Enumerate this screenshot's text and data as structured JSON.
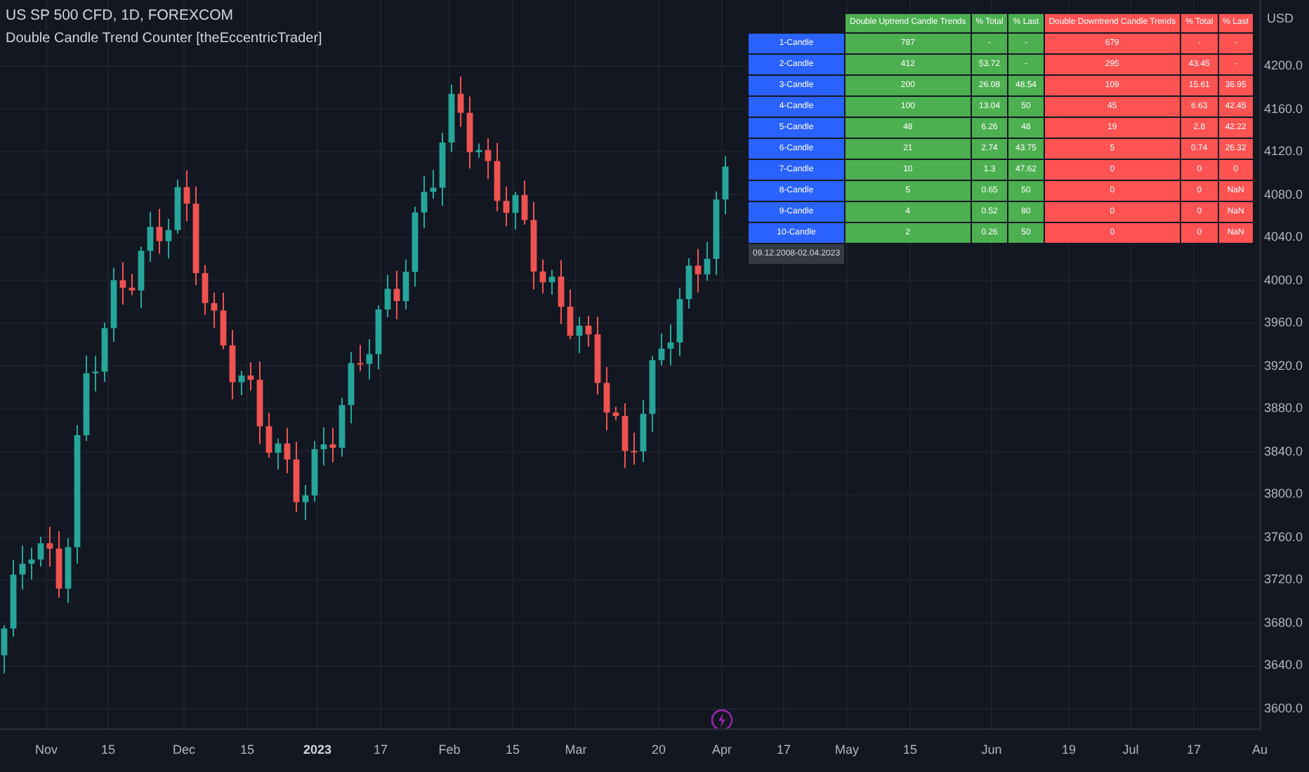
{
  "header": {
    "symbol": "US SP 500 CFD, 1D, FOREXCOM",
    "indicator": "Double Candle Trend Counter [theEccentricTrader]"
  },
  "price_axis": {
    "currency": "USD",
    "labels": [
      "4200.0",
      "4160.0",
      "4120.0",
      "4080.0",
      "4040.0",
      "4000.0",
      "3960.0",
      "3920.0",
      "3880.0",
      "3840.0",
      "3800.0",
      "3760.0",
      "3720.0",
      "3680.0",
      "3640.0",
      "3600.0"
    ]
  },
  "time_axis": {
    "labels": [
      {
        "text": "Nov",
        "kind": "month"
      },
      {
        "text": "15",
        "kind": "day"
      },
      {
        "text": "Dec",
        "kind": "month"
      },
      {
        "text": "15",
        "kind": "day"
      },
      {
        "text": "2023",
        "kind": "year"
      },
      {
        "text": "17",
        "kind": "day"
      },
      {
        "text": "Feb",
        "kind": "month"
      },
      {
        "text": "15",
        "kind": "day"
      },
      {
        "text": "Mar",
        "kind": "month"
      },
      {
        "text": "20",
        "kind": "day"
      },
      {
        "text": "Apr",
        "kind": "month"
      },
      {
        "text": "17",
        "kind": "day"
      },
      {
        "text": "May",
        "kind": "month"
      },
      {
        "text": "15",
        "kind": "day"
      },
      {
        "text": "Jun",
        "kind": "month"
      },
      {
        "text": "19",
        "kind": "day"
      },
      {
        "text": "Jul",
        "kind": "month"
      },
      {
        "text": "17",
        "kind": "day"
      },
      {
        "text": "Au",
        "kind": "month"
      }
    ]
  },
  "stats_table": {
    "columns": [
      {
        "label": "Double Uptrend Candle Trends",
        "kind": "up"
      },
      {
        "label": "% Total",
        "kind": "up"
      },
      {
        "label": "% Last",
        "kind": "up"
      },
      {
        "label": "Double Downtrend Candle Trends",
        "kind": "down"
      },
      {
        "label": "% Total",
        "kind": "down"
      },
      {
        "label": "% Last",
        "kind": "down"
      }
    ],
    "rows": [
      {
        "label": "1-Candle",
        "cells": [
          "787",
          "-",
          "-",
          "679",
          "-",
          "-"
        ]
      },
      {
        "label": "2-Candle",
        "cells": [
          "412",
          "53.72",
          "-",
          "295",
          "43.45",
          "-"
        ]
      },
      {
        "label": "3-Candle",
        "cells": [
          "200",
          "26.08",
          "48.54",
          "109",
          "15.61",
          "36.95"
        ]
      },
      {
        "label": "4-Candle",
        "cells": [
          "100",
          "13.04",
          "50",
          "45",
          "6.63",
          "42.45"
        ]
      },
      {
        "label": "5-Candle",
        "cells": [
          "48",
          "6.26",
          "48",
          "19",
          "2.8",
          "42.22"
        ]
      },
      {
        "label": "6-Candle",
        "cells": [
          "21",
          "2.74",
          "43.75",
          "5",
          "0.74",
          "26.32"
        ]
      },
      {
        "label": "7-Candle",
        "cells": [
          "10",
          "1.3",
          "47.62",
          "0",
          "0",
          "0"
        ]
      },
      {
        "label": "8-Candle",
        "cells": [
          "5",
          "0.65",
          "50",
          "0",
          "0",
          "NaN"
        ]
      },
      {
        "label": "9-Candle",
        "cells": [
          "4",
          "0.52",
          "80",
          "0",
          "0",
          "NaN"
        ]
      },
      {
        "label": "10-Candle",
        "cells": [
          "2",
          "0.26",
          "50",
          "0",
          "0",
          "NaN"
        ]
      }
    ],
    "date_range": "09.12.2008-02.04.2023"
  }
}
